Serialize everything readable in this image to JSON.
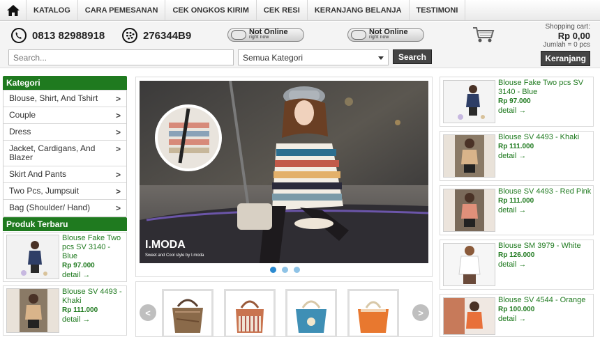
{
  "nav": {
    "home_icon": "home-icon",
    "items": [
      "KATALOG",
      "CARA PEMESANAN",
      "CEK ONGKOS KIRIM",
      "CEK RESI",
      "KERANJANG BELANJA",
      "TESTIMONI"
    ]
  },
  "header": {
    "phone": "0813 82988918",
    "bbm_pin": "276344B9",
    "status_1": {
      "line1": "Not Online",
      "line2": "right now"
    },
    "status_2": {
      "line1": "Not Online",
      "line2": "right now"
    }
  },
  "cart": {
    "label": "Shopping cart:",
    "total": "Rp 0,00",
    "quantity": "Jumlah = 0 pcs",
    "button": "Keranjang"
  },
  "search": {
    "placeholder": "Search...",
    "category_selected": "Semua Kategori",
    "button": "Search"
  },
  "sidebar": {
    "categories_title": "Kategori",
    "categories": [
      "Blouse, Shirt, And Tshirt",
      "Couple",
      "Dress",
      "Jacket, Cardigans, And Blazer",
      "Skirt And Pants",
      "Two Pcs, Jumpsuit",
      "Bag (Shoulder/ Hand)"
    ],
    "latest_title": "Produk Terbaru",
    "latest": [
      {
        "name": "Blouse Fake Two pcs SV 3140 - Blue",
        "price": "Rp 97.000",
        "detail": "detail →"
      },
      {
        "name": "Blouse SV 4493 - Khaki",
        "price": "Rp 111.000",
        "detail": "detail →"
      }
    ]
  },
  "slider": {
    "watermark": "I.MODA",
    "watermark_sub": "Sweet and Cool style by I.moda",
    "slide_count": 3,
    "active_slide": 1
  },
  "carousel": {
    "prev_icon": "chevron-left-icon",
    "next_icon": "chevron-right-icon",
    "items": [
      "bag-1",
      "bag-2",
      "bag-3",
      "bag-4"
    ],
    "colors": [
      "#8a6a4a",
      "#c9744f",
      "#3f8fb5",
      "#e8782f"
    ]
  },
  "right": {
    "products": [
      {
        "name": "Blouse Fake Two pcs SV 3140 - Blue",
        "price": "Rp 97.000",
        "detail": "detail →"
      },
      {
        "name": "Blouse SV 4493 - Khaki",
        "price": "Rp 111.000",
        "detail": "detail →"
      },
      {
        "name": "Blouse SV 4493 - Red Pink",
        "price": "Rp 111.000",
        "detail": "detail →"
      },
      {
        "name": "Blouse SM 3979 - White",
        "price": "Rp 126.000",
        "detail": "detail →"
      },
      {
        "name": "Blouse SV 4544 - Orange",
        "price": "Rp 100.000",
        "detail": "detail →"
      }
    ]
  },
  "colors": {
    "accent_green": "#1f7a1f",
    "dark_button": "#444444",
    "dot_active": "#2b8ad0"
  }
}
